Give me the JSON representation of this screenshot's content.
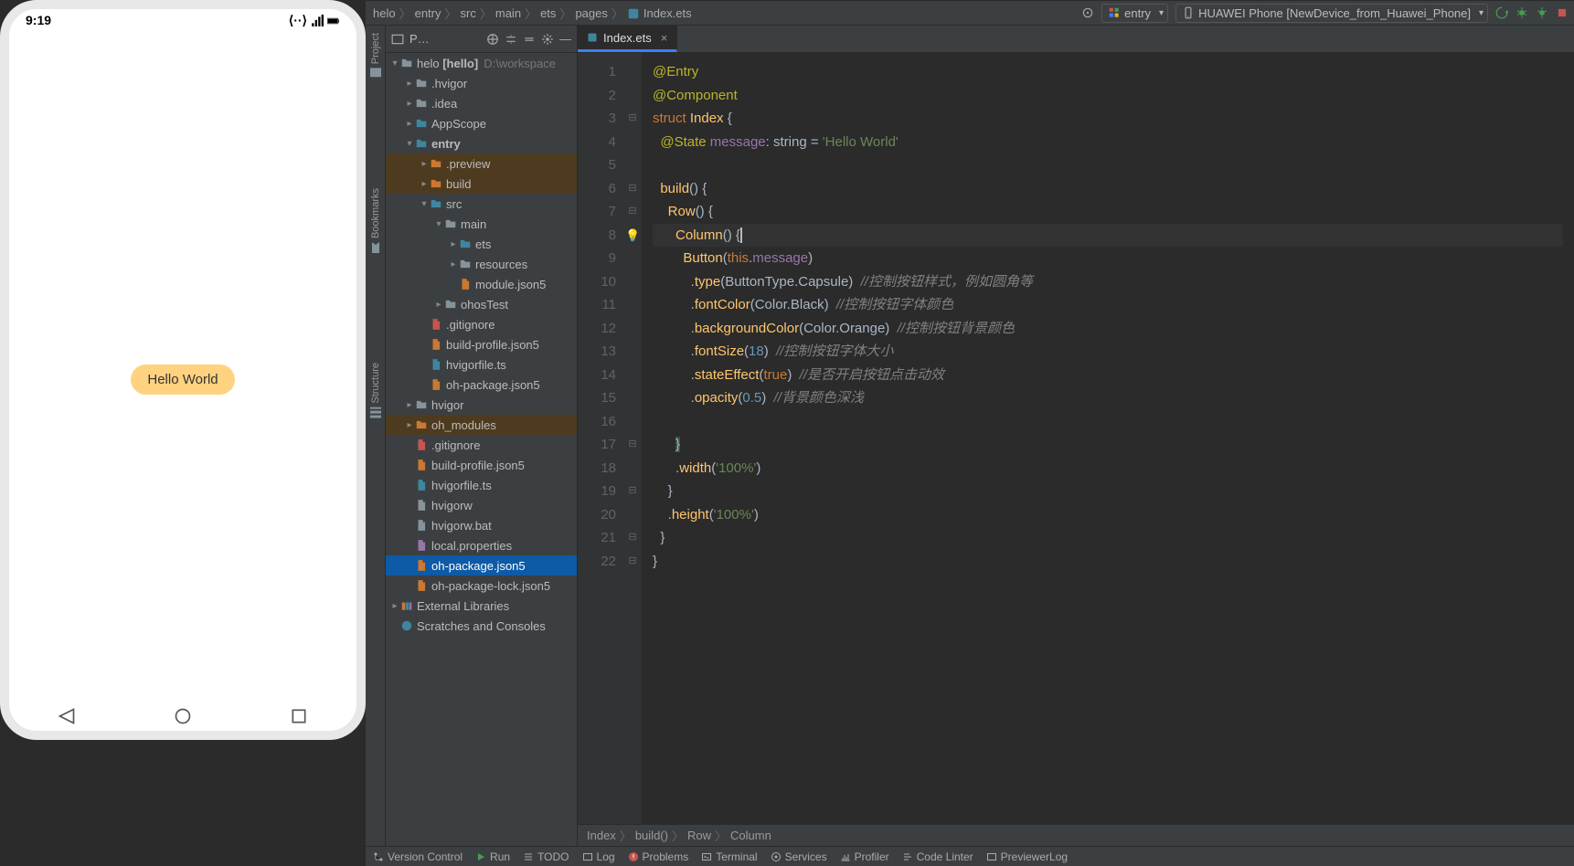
{
  "phone": {
    "time": "9:19",
    "button_text": "Hello World"
  },
  "breadcrumb": [
    "helo",
    "entry",
    "src",
    "main",
    "ets",
    "pages",
    "Index.ets"
  ],
  "run_config": "entry",
  "device": "HUAWEI Phone [NewDevice_from_Huawei_Phone]",
  "project_header": "P…",
  "tree": {
    "root": "helo",
    "root_suffix": "[hello]",
    "root_path": "D:\\workspace",
    "items": [
      {
        "d": 1,
        "t": ".hvigor",
        "arrow": "r",
        "cls": ""
      },
      {
        "d": 1,
        "t": ".idea",
        "arrow": "r",
        "cls": ""
      },
      {
        "d": 1,
        "t": "AppScope",
        "arrow": "r",
        "cls": "b"
      },
      {
        "d": 1,
        "t": "entry",
        "arrow": "d",
        "cls": "b",
        "bold": true
      },
      {
        "d": 2,
        "t": ".preview",
        "arrow": "r",
        "cls": "o",
        "row": "hl-preview"
      },
      {
        "d": 2,
        "t": "build",
        "arrow": "r",
        "cls": "o",
        "row": "hl-build"
      },
      {
        "d": 2,
        "t": "src",
        "arrow": "d",
        "cls": "b"
      },
      {
        "d": 3,
        "t": "main",
        "arrow": "d",
        "cls": ""
      },
      {
        "d": 4,
        "t": "ets",
        "arrow": "r",
        "cls": "b"
      },
      {
        "d": 4,
        "t": "resources",
        "arrow": "r",
        "cls": ""
      },
      {
        "d": 4,
        "t": "module.json5",
        "file": true,
        "fi": "json"
      },
      {
        "d": 3,
        "t": "ohosTest",
        "arrow": "r",
        "cls": ""
      },
      {
        "d": 2,
        "t": ".gitignore",
        "file": true,
        "fi": "git"
      },
      {
        "d": 2,
        "t": "build-profile.json5",
        "file": true,
        "fi": "json"
      },
      {
        "d": 2,
        "t": "hvigorfile.ts",
        "file": true,
        "fi": "ts"
      },
      {
        "d": 2,
        "t": "oh-package.json5",
        "file": true,
        "fi": "json"
      },
      {
        "d": 1,
        "t": "hvigor",
        "arrow": "r",
        "cls": ""
      },
      {
        "d": 1,
        "t": "oh_modules",
        "arrow": "r",
        "cls": "o",
        "row": "hl-oh"
      },
      {
        "d": 1,
        "t": ".gitignore",
        "file": true,
        "fi": "git"
      },
      {
        "d": 1,
        "t": "build-profile.json5",
        "file": true,
        "fi": "json"
      },
      {
        "d": 1,
        "t": "hvigorfile.ts",
        "file": true,
        "fi": "ts"
      },
      {
        "d": 1,
        "t": "hvigorw",
        "file": true,
        "fi": "txt"
      },
      {
        "d": 1,
        "t": "hvigorw.bat",
        "file": true,
        "fi": "bat"
      },
      {
        "d": 1,
        "t": "local.properties",
        "file": true,
        "fi": "prop"
      },
      {
        "d": 1,
        "t": "oh-package.json5",
        "file": true,
        "fi": "json",
        "row": "selected"
      },
      {
        "d": 1,
        "t": "oh-package-lock.json5",
        "file": true,
        "fi": "json"
      }
    ],
    "ext_lib": "External Libraries",
    "scratches": "Scratches and Consoles"
  },
  "tab": "Index.ets",
  "editor_bc": [
    "Index",
    "build()",
    "Row",
    "Column"
  ],
  "bottom": [
    "Version Control",
    "Run",
    "TODO",
    "Log",
    "Problems",
    "Terminal",
    "Services",
    "Profiler",
    "Code Linter",
    "PreviewerLog"
  ],
  "code_lines": [
    {
      "n": 1,
      "html": "<span class='dec'>@Entry</span>"
    },
    {
      "n": 2,
      "html": "<span class='dec'>@Component</span>"
    },
    {
      "n": 3,
      "html": "<span class='kw'>struct</span> <span class='fn-call'>Index</span> {"
    },
    {
      "n": 4,
      "html": "  <span class='dec'>@State</span> <span class='prop'>message</span>: <span class='type'>string</span> = <span class='str'>'Hello World'</span>"
    },
    {
      "n": 5,
      "html": ""
    },
    {
      "n": 6,
      "html": "  <span class='fn-call'>build</span>() {"
    },
    {
      "n": 7,
      "html": "    <span class='fn-call'>Row</span>() {"
    },
    {
      "n": 8,
      "html": "      <span class='fn-call'>Column</span>() {<span class='caret'></span>",
      "hl": true,
      "bulb": true
    },
    {
      "n": 9,
      "html": "        <span class='fn-call'>Button</span>(<span class='kw'>this</span>.<span class='prop'>message</span>)"
    },
    {
      "n": 10,
      "html": "          .<span class='fn-call'>type</span>(ButtonType.Capsule)  <span class='com'>//控制按钮样式，例如圆角等</span>"
    },
    {
      "n": 11,
      "html": "          .<span class='fn-call'>fontColor</span>(Color.Black)  <span class='com'>//控制按钮字体颜色</span>"
    },
    {
      "n": 12,
      "html": "          .<span class='fn-call'>backgroundColor</span>(Color.Orange)  <span class='com'>//控制按钮背景颜色</span>"
    },
    {
      "n": 13,
      "html": "          .<span class='fn-call'>fontSize</span>(<span class='num'>18</span>)  <span class='com'>//控制按钮字体大小</span>"
    },
    {
      "n": 14,
      "html": "          .<span class='fn-call'>stateEffect</span>(<span class='kw'>true</span>)  <span class='com'>//是否开启按钮点击动效</span>"
    },
    {
      "n": 15,
      "html": "          .<span class='fn-call'>opacity</span>(<span class='num'>0.5</span>)  <span class='com'>//背景颜色深浅</span>"
    },
    {
      "n": 16,
      "html": ""
    },
    {
      "n": 17,
      "html": "      <span class='brace-hl'>}</span>"
    },
    {
      "n": 18,
      "html": "      .<span class='fn-call'>width</span>(<span class='str'>'100%'</span>)"
    },
    {
      "n": 19,
      "html": "    }"
    },
    {
      "n": 20,
      "html": "    .<span class='fn-call'>height</span>(<span class='str'>'100%'</span>)"
    },
    {
      "n": 21,
      "html": "  }"
    },
    {
      "n": 22,
      "html": "}"
    }
  ]
}
